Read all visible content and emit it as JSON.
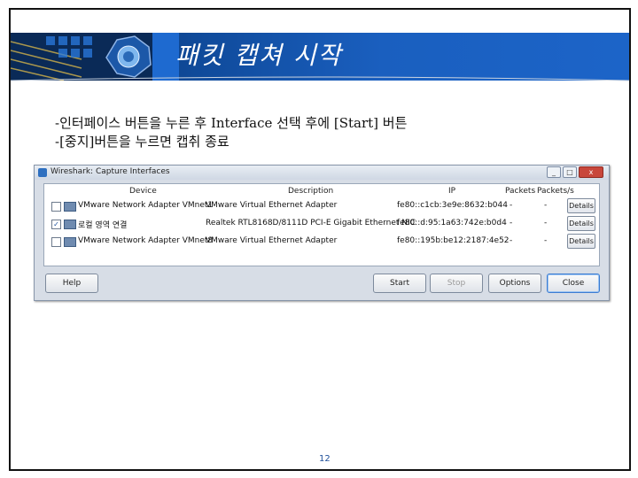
{
  "slide": {
    "title": "패킷 캡쳐 시작",
    "instructions": [
      "-인터페이스 버튼을 누른 후 Interface 선택 후에 [Start] 버튼",
      "-[중지]버튼을 누르면 캡취 종료"
    ],
    "page_number": "12"
  },
  "dialog": {
    "title": "Wireshark: Capture Interfaces",
    "window_controls": [
      "_",
      "□",
      "x"
    ],
    "columns": {
      "device": "Device",
      "description": "Description",
      "ip": "IP",
      "packets": "Packets",
      "packets_per_sec": "Packets/s"
    },
    "rows": [
      {
        "checked": false,
        "device": "VMware Network Adapter VMnet1",
        "description": "VMware Virtual Ethernet Adapter",
        "ip": "fe80::c1cb:3e9e:8632:b044",
        "packets": "-",
        "packets_per_sec": "-",
        "details": "Details"
      },
      {
        "checked": true,
        "device": "로컬 영역 연결",
        "description": "Realtek RTL8168D/8111D PCI-E Gigabit Ethernet NIC",
        "ip": "fe80::d:95:1a63:742e:b0d4",
        "packets": "-",
        "packets_per_sec": "-",
        "details": "Details"
      },
      {
        "checked": false,
        "device": "VMware Network Adapter VMnet8",
        "description": "VMware Virtual Ethernet Adapter",
        "ip": "fe80::195b:be12:2187:4e52",
        "packets": "-",
        "packets_per_sec": "-",
        "details": "Details"
      }
    ],
    "buttons": {
      "help": "Help",
      "start": "Start",
      "stop": "Stop",
      "options": "Options",
      "close": "Close"
    }
  },
  "colors": {
    "banner": "#1a5fbf",
    "page_number": "#1f4f9a"
  }
}
